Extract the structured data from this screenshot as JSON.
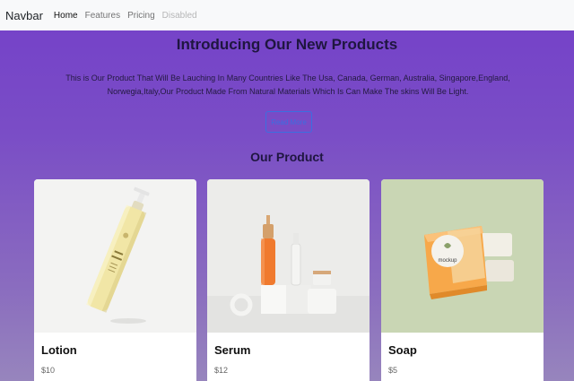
{
  "navbar": {
    "brand": "Navbar",
    "links": [
      "Home",
      "Features",
      "Pricing",
      "Disabled"
    ]
  },
  "hero": {
    "title": "Introducing Our New Products",
    "text": "This is Our Product That Will Be Lauching In Many Countries Like The Usa, Canada, German, Australia, Singapore,England, Norwegia,Italy,Our Product Made From Natural Materials Which Is Can Make The skins Will Be Light.",
    "button": "Read More"
  },
  "products_section": {
    "title": "Our Product",
    "items": [
      {
        "name": "Lotion",
        "price": "$10"
      },
      {
        "name": "Serum",
        "price": "$12"
      },
      {
        "name": "Soap",
        "price": "$5"
      }
    ],
    "soap_tag_text": "mockup"
  },
  "colors": {
    "gradient_top": "#7440c9",
    "gradient_bottom": "#9785bd",
    "button_outline": "#3b6fe0",
    "navbar_bg": "#f8f9fa"
  }
}
